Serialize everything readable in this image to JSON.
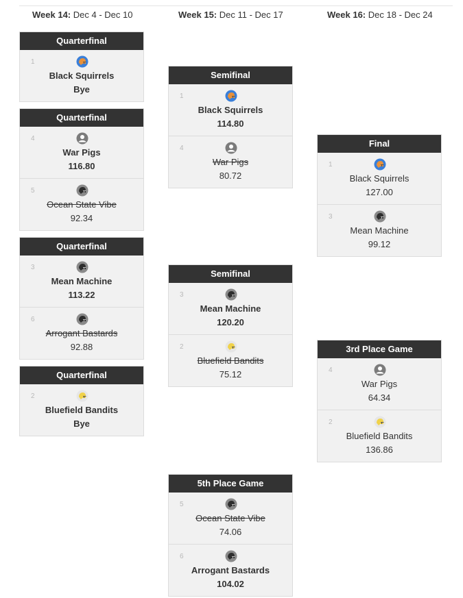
{
  "weeks": [
    {
      "label": "Week 14:",
      "dates": "Dec 4 - Dec 10"
    },
    {
      "label": "Week 15:",
      "dates": "Dec 11 - Dec 17"
    },
    {
      "label": "Week 16:",
      "dates": "Dec 18 - Dec 24"
    }
  ],
  "colors": {
    "header_bg": "#333333",
    "box_bg": "#f1f1f1",
    "helmet_orange": "#e8913a",
    "helmet_blue_ring": "#3a7fd9",
    "helmet_dark": "#333333",
    "helmet_yellow": "#f0d24a"
  },
  "matchups": [
    {
      "title": "Quarterfinal",
      "teams": [
        {
          "seed": "1",
          "name": "Black Squirrels",
          "score": "Bye",
          "icon": "helmet-orange-icon",
          "result": "win"
        }
      ]
    },
    {
      "title": "Quarterfinal",
      "teams": [
        {
          "seed": "4",
          "name": "War Pigs",
          "score": "116.80",
          "icon": "user-avatar-icon",
          "result": "win"
        },
        {
          "seed": "5",
          "name": "Ocean State Vibe",
          "score": "92.34",
          "icon": "helmet-dark-icon",
          "result": "lose"
        }
      ]
    },
    {
      "title": "Quarterfinal",
      "teams": [
        {
          "seed": "3",
          "name": "Mean Machine",
          "score": "113.22",
          "icon": "helmet-dark-icon",
          "result": "win"
        },
        {
          "seed": "6",
          "name": "Arrogant Bastards",
          "score": "92.88",
          "icon": "helmet-dark-icon",
          "result": "lose"
        }
      ]
    },
    {
      "title": "Quarterfinal",
      "teams": [
        {
          "seed": "2",
          "name": "Bluefield Bandits",
          "score": "Bye",
          "icon": "helmet-yellow-icon",
          "result": "win"
        }
      ]
    },
    {
      "title": "Semifinal",
      "teams": [
        {
          "seed": "1",
          "name": "Black Squirrels",
          "score": "114.80",
          "icon": "helmet-orange-icon",
          "result": "win"
        },
        {
          "seed": "4",
          "name": "War Pigs",
          "score": "80.72",
          "icon": "user-avatar-icon",
          "result": "lose"
        }
      ]
    },
    {
      "title": "Semifinal",
      "teams": [
        {
          "seed": "3",
          "name": "Mean Machine",
          "score": "120.20",
          "icon": "helmet-dark-icon",
          "result": "win"
        },
        {
          "seed": "2",
          "name": "Bluefield Bandits",
          "score": "75.12",
          "icon": "helmet-yellow-icon",
          "result": "lose"
        }
      ]
    },
    {
      "title": "5th Place Game",
      "teams": [
        {
          "seed": "5",
          "name": "Ocean State Vibe",
          "score": "74.06",
          "icon": "helmet-dark-icon",
          "result": "lose"
        },
        {
          "seed": "6",
          "name": "Arrogant Bastards",
          "score": "104.02",
          "icon": "helmet-dark-icon",
          "result": "win"
        }
      ]
    },
    {
      "title": "Final",
      "teams": [
        {
          "seed": "1",
          "name": "Black Squirrels",
          "score": "127.00",
          "icon": "helmet-orange-icon",
          "result": "normal"
        },
        {
          "seed": "3",
          "name": "Mean Machine",
          "score": "99.12",
          "icon": "helmet-dark-icon",
          "result": "normal"
        }
      ]
    },
    {
      "title": "3rd Place Game",
      "teams": [
        {
          "seed": "4",
          "name": "War Pigs",
          "score": "64.34",
          "icon": "user-avatar-icon",
          "result": "normal"
        },
        {
          "seed": "2",
          "name": "Bluefield Bandits",
          "score": "136.86",
          "icon": "helmet-yellow-icon",
          "result": "normal"
        }
      ]
    }
  ]
}
